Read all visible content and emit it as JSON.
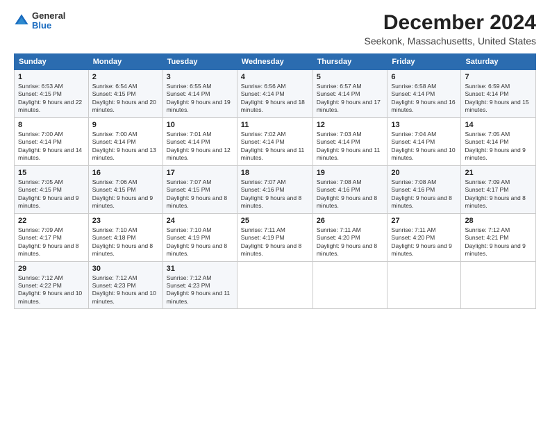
{
  "logo": {
    "general": "General",
    "blue": "Blue"
  },
  "title": "December 2024",
  "subtitle": "Seekonk, Massachusetts, United States",
  "header_days": [
    "Sunday",
    "Monday",
    "Tuesday",
    "Wednesday",
    "Thursday",
    "Friday",
    "Saturday"
  ],
  "weeks": [
    [
      {
        "day": "1",
        "rise": "Sunrise: 6:53 AM",
        "set": "Sunset: 4:15 PM",
        "daylight": "Daylight: 9 hours and 22 minutes."
      },
      {
        "day": "2",
        "rise": "Sunrise: 6:54 AM",
        "set": "Sunset: 4:15 PM",
        "daylight": "Daylight: 9 hours and 20 minutes."
      },
      {
        "day": "3",
        "rise": "Sunrise: 6:55 AM",
        "set": "Sunset: 4:14 PM",
        "daylight": "Daylight: 9 hours and 19 minutes."
      },
      {
        "day": "4",
        "rise": "Sunrise: 6:56 AM",
        "set": "Sunset: 4:14 PM",
        "daylight": "Daylight: 9 hours and 18 minutes."
      },
      {
        "day": "5",
        "rise": "Sunrise: 6:57 AM",
        "set": "Sunset: 4:14 PM",
        "daylight": "Daylight: 9 hours and 17 minutes."
      },
      {
        "day": "6",
        "rise": "Sunrise: 6:58 AM",
        "set": "Sunset: 4:14 PM",
        "daylight": "Daylight: 9 hours and 16 minutes."
      },
      {
        "day": "7",
        "rise": "Sunrise: 6:59 AM",
        "set": "Sunset: 4:14 PM",
        "daylight": "Daylight: 9 hours and 15 minutes."
      }
    ],
    [
      {
        "day": "8",
        "rise": "Sunrise: 7:00 AM",
        "set": "Sunset: 4:14 PM",
        "daylight": "Daylight: 9 hours and 14 minutes."
      },
      {
        "day": "9",
        "rise": "Sunrise: 7:00 AM",
        "set": "Sunset: 4:14 PM",
        "daylight": "Daylight: 9 hours and 13 minutes."
      },
      {
        "day": "10",
        "rise": "Sunrise: 7:01 AM",
        "set": "Sunset: 4:14 PM",
        "daylight": "Daylight: 9 hours and 12 minutes."
      },
      {
        "day": "11",
        "rise": "Sunrise: 7:02 AM",
        "set": "Sunset: 4:14 PM",
        "daylight": "Daylight: 9 hours and 11 minutes."
      },
      {
        "day": "12",
        "rise": "Sunrise: 7:03 AM",
        "set": "Sunset: 4:14 PM",
        "daylight": "Daylight: 9 hours and 11 minutes."
      },
      {
        "day": "13",
        "rise": "Sunrise: 7:04 AM",
        "set": "Sunset: 4:14 PM",
        "daylight": "Daylight: 9 hours and 10 minutes."
      },
      {
        "day": "14",
        "rise": "Sunrise: 7:05 AM",
        "set": "Sunset: 4:14 PM",
        "daylight": "Daylight: 9 hours and 9 minutes."
      }
    ],
    [
      {
        "day": "15",
        "rise": "Sunrise: 7:05 AM",
        "set": "Sunset: 4:15 PM",
        "daylight": "Daylight: 9 hours and 9 minutes."
      },
      {
        "day": "16",
        "rise": "Sunrise: 7:06 AM",
        "set": "Sunset: 4:15 PM",
        "daylight": "Daylight: 9 hours and 9 minutes."
      },
      {
        "day": "17",
        "rise": "Sunrise: 7:07 AM",
        "set": "Sunset: 4:15 PM",
        "daylight": "Daylight: 9 hours and 8 minutes."
      },
      {
        "day": "18",
        "rise": "Sunrise: 7:07 AM",
        "set": "Sunset: 4:16 PM",
        "daylight": "Daylight: 9 hours and 8 minutes."
      },
      {
        "day": "19",
        "rise": "Sunrise: 7:08 AM",
        "set": "Sunset: 4:16 PM",
        "daylight": "Daylight: 9 hours and 8 minutes."
      },
      {
        "day": "20",
        "rise": "Sunrise: 7:08 AM",
        "set": "Sunset: 4:16 PM",
        "daylight": "Daylight: 9 hours and 8 minutes."
      },
      {
        "day": "21",
        "rise": "Sunrise: 7:09 AM",
        "set": "Sunset: 4:17 PM",
        "daylight": "Daylight: 9 hours and 8 minutes."
      }
    ],
    [
      {
        "day": "22",
        "rise": "Sunrise: 7:09 AM",
        "set": "Sunset: 4:17 PM",
        "daylight": "Daylight: 9 hours and 8 minutes."
      },
      {
        "day": "23",
        "rise": "Sunrise: 7:10 AM",
        "set": "Sunset: 4:18 PM",
        "daylight": "Daylight: 9 hours and 8 minutes."
      },
      {
        "day": "24",
        "rise": "Sunrise: 7:10 AM",
        "set": "Sunset: 4:19 PM",
        "daylight": "Daylight: 9 hours and 8 minutes."
      },
      {
        "day": "25",
        "rise": "Sunrise: 7:11 AM",
        "set": "Sunset: 4:19 PM",
        "daylight": "Daylight: 9 hours and 8 minutes."
      },
      {
        "day": "26",
        "rise": "Sunrise: 7:11 AM",
        "set": "Sunset: 4:20 PM",
        "daylight": "Daylight: 9 hours and 8 minutes."
      },
      {
        "day": "27",
        "rise": "Sunrise: 7:11 AM",
        "set": "Sunset: 4:20 PM",
        "daylight": "Daylight: 9 hours and 9 minutes."
      },
      {
        "day": "28",
        "rise": "Sunrise: 7:12 AM",
        "set": "Sunset: 4:21 PM",
        "daylight": "Daylight: 9 hours and 9 minutes."
      }
    ],
    [
      {
        "day": "29",
        "rise": "Sunrise: 7:12 AM",
        "set": "Sunset: 4:22 PM",
        "daylight": "Daylight: 9 hours and 10 minutes."
      },
      {
        "day": "30",
        "rise": "Sunrise: 7:12 AM",
        "set": "Sunset: 4:23 PM",
        "daylight": "Daylight: 9 hours and 10 minutes."
      },
      {
        "day": "31",
        "rise": "Sunrise: 7:12 AM",
        "set": "Sunset: 4:23 PM",
        "daylight": "Daylight: 9 hours and 11 minutes."
      },
      null,
      null,
      null,
      null
    ]
  ]
}
